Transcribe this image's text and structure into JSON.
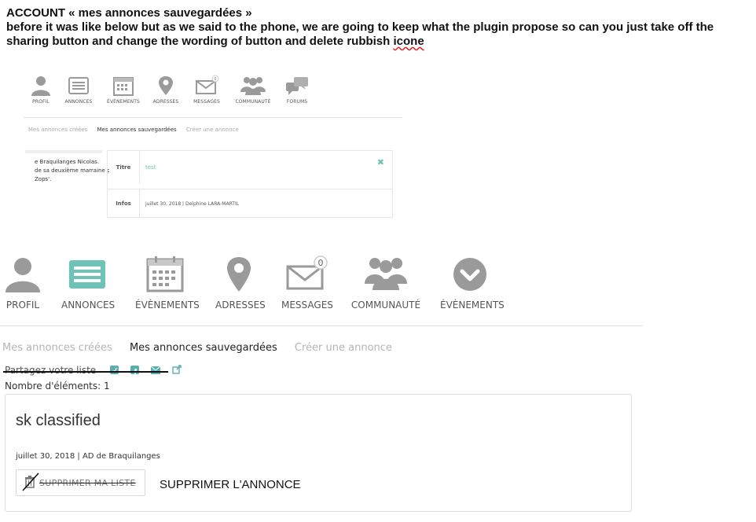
{
  "note": {
    "line1": "ACCOUNT « mes annonces sauvegardées »",
    "line2": "before it was like below but as we said to the phone, we are going to keep what the plugin propose so can you just take off  the",
    "line3_a": "sharing button and change the wording of button and delete rubbish ",
    "line3_b": "icone"
  },
  "old_mock": {
    "nav": [
      {
        "label": "PROFIL",
        "icon": "person-icon"
      },
      {
        "label": "ANNONCES",
        "icon": "list-icon"
      },
      {
        "label": "ÉVÈNEMENTS",
        "icon": "calendar-icon"
      },
      {
        "label": "ADRESSES",
        "icon": "map-pin-icon"
      },
      {
        "label": "MESSAGES",
        "icon": "envelope-icon",
        "badge": "0"
      },
      {
        "label": "COMMUNAUTÉ",
        "icon": "group-icon"
      },
      {
        "label": "FORUMS",
        "icon": "chat-icon"
      }
    ],
    "tabs": [
      "Mes annonces créées",
      "Mes annonces sauvegardées",
      "Créer une annonce"
    ],
    "snippet": [
      "e Braquilanges Nicolas.",
      "de sa deuxième marraine p",
      "Zops'."
    ],
    "rows": [
      {
        "key": "Titre",
        "value": "test"
      },
      {
        "key": "Infos",
        "value": "juillet 30, 2018 | Delphine LARA-MARTIL"
      }
    ],
    "close_symbol": "✖"
  },
  "new_mock": {
    "nav": [
      {
        "label": "PROFIL",
        "icon": "person-icon"
      },
      {
        "label": "ANNONCES",
        "icon": "list-icon"
      },
      {
        "label": "ÉVÈNEMENTS",
        "icon": "calendar-icon"
      },
      {
        "label": "ADRESSES",
        "icon": "map-pin-icon"
      },
      {
        "label": "MESSAGES",
        "icon": "envelope-icon",
        "badge": "0"
      },
      {
        "label": "COMMUNAUTÉ",
        "icon": "group-icon"
      },
      {
        "label": "ÉVÈNEMENTS",
        "icon": "check-circle-icon"
      }
    ],
    "tabs": [
      "Mes annonces créées",
      "Mes annonces sauvegardées",
      "Créer une annonce"
    ],
    "share_label": "Partagez votre liste",
    "count_label": "Nombre d'éléments: 1",
    "card": {
      "title": "sk classified",
      "meta": "juillet 30, 2018 | AD de Braquilanges",
      "button_label": "SUPPRIMER MA LISTE",
      "new_wording": "SUPPRIMER L'ANNONCE"
    }
  },
  "colors": {
    "accent": "#6cc3b6",
    "icon_grey": "#9a9a9a",
    "share_icon": "#5aaeb0"
  }
}
